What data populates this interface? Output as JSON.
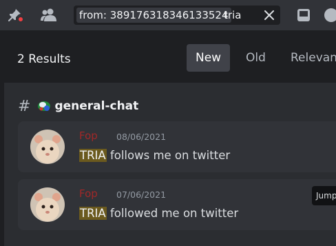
{
  "toolbar": {
    "search": {
      "filter_chip": "from: 389176318346133524",
      "query": "tria"
    }
  },
  "results": {
    "count_label": "2 Results",
    "sort_tabs": [
      {
        "label": "New",
        "active": true
      },
      {
        "label": "Old",
        "active": false
      },
      {
        "label": "Relevant",
        "active": false
      }
    ],
    "channel": {
      "hash": "#",
      "name": "general-chat"
    },
    "messages": [
      {
        "author": "Fop",
        "timestamp": "08/06/2021",
        "highlight": "TRIA",
        "text": " follows me on twitter"
      },
      {
        "author": "Fop",
        "timestamp": "07/06/2021",
        "highlight": "TRIA",
        "text": " followed me on twitter"
      }
    ],
    "jump_tooltip": "Jump"
  },
  "colors": {
    "background": "#1e1f22",
    "panel": "#2b2d31",
    "card": "#313338",
    "author": "#a12828",
    "highlight": "#6b5a1e",
    "notification_dot": "#f23f42"
  }
}
